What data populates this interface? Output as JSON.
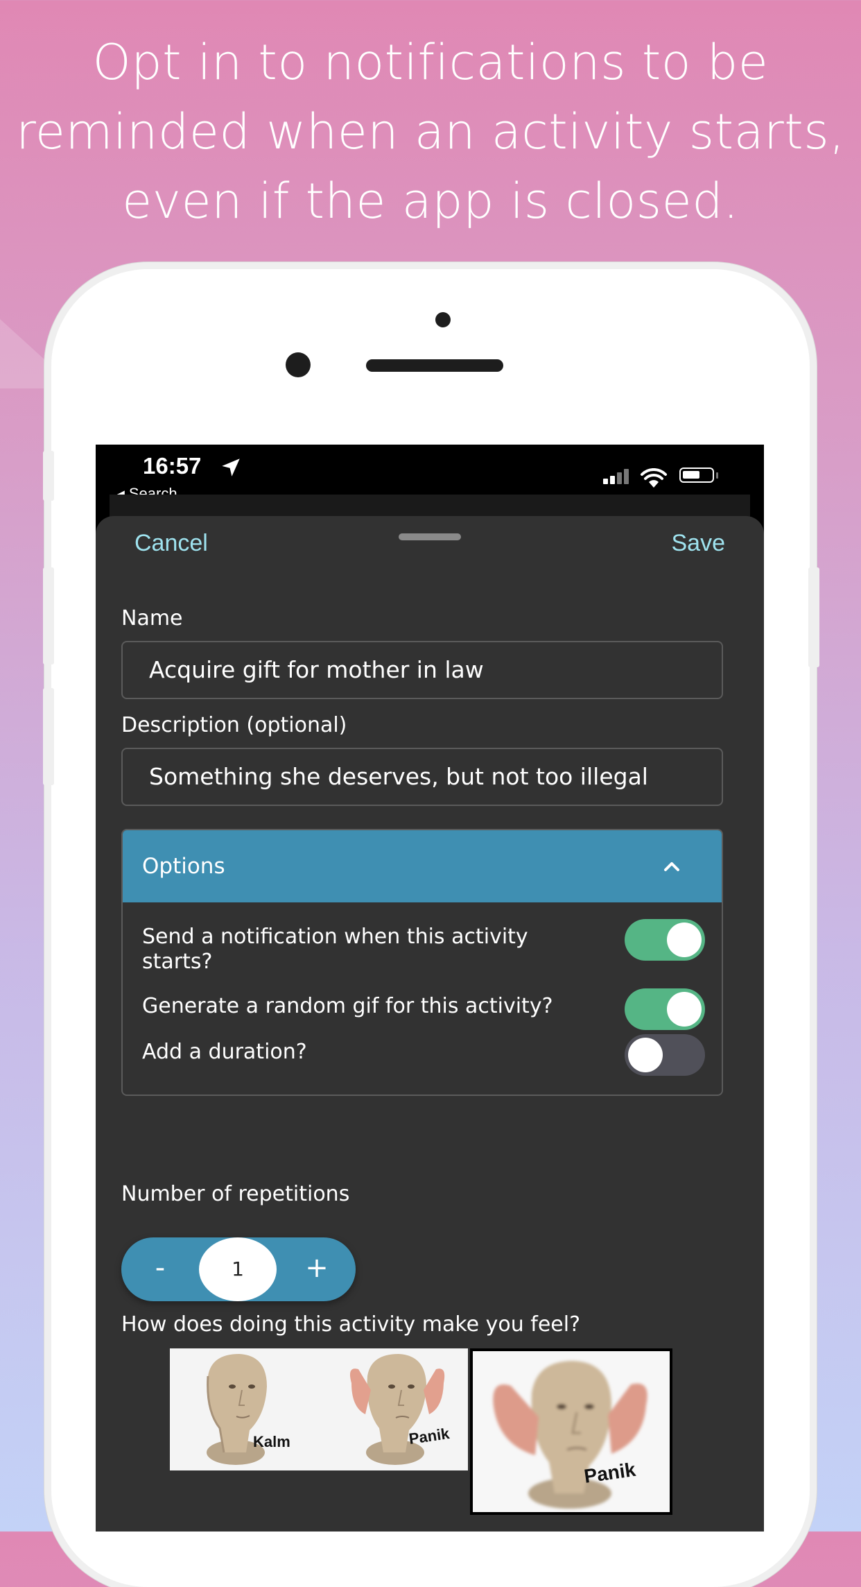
{
  "headline": {
    "line1": "Opt in to notifications to be",
    "line2": "reminded when an activity starts,",
    "line3": "even if the app is closed."
  },
  "status_bar": {
    "time": "16:57",
    "back_label": "Search"
  },
  "nav": {
    "cancel": "Cancel",
    "save": "Save"
  },
  "form": {
    "name_label": "Name",
    "name_value": "Acquire gift for mother in law",
    "description_label": "Description (optional)",
    "description_value": "Something she deserves, but not too illegal"
  },
  "options": {
    "title": "Options",
    "items": [
      {
        "label_line1": "Send a notification when this activity",
        "label_line2": "starts?",
        "enabled": true
      },
      {
        "label": "Generate a random gif for this activity?",
        "enabled": true
      },
      {
        "label": "Add a duration?",
        "enabled": false
      }
    ]
  },
  "repetitions": {
    "label": "Number of repetitions",
    "minus": "-",
    "value": "1",
    "plus": "+"
  },
  "feeling": {
    "question": "How does doing this activity make you feel?",
    "memes": [
      {
        "caption": "Kalm"
      },
      {
        "caption": "Panik"
      },
      {
        "caption": "Panik",
        "selected": true
      }
    ]
  },
  "colors": {
    "accent": "#3f8fb2",
    "toggle_on": "#55b585",
    "toggle_off": "#505059",
    "link": "#9fe3ef",
    "sheet": "#323232"
  }
}
